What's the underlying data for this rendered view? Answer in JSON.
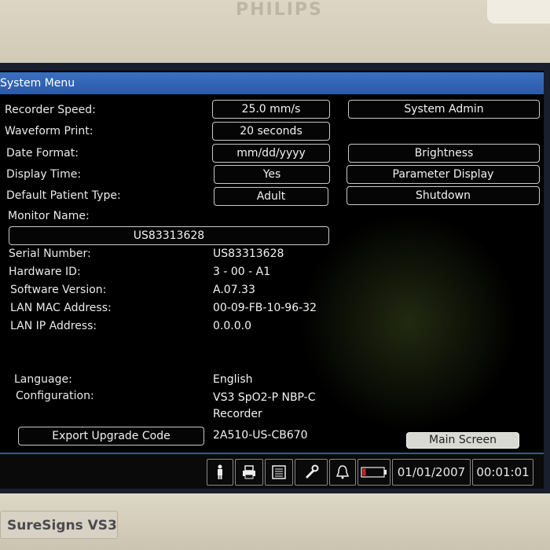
{
  "window": {
    "title": "System Menu"
  },
  "settings": {
    "recorder_speed": {
      "label": "Recorder Speed:",
      "value": "25.0 mm/s"
    },
    "waveform_print": {
      "label": "Waveform Print:",
      "value": "20 seconds"
    },
    "date_format": {
      "label": "Date Format:",
      "value": "mm/dd/yyyy"
    },
    "display_time": {
      "label": "Display Time:",
      "value": "Yes"
    },
    "default_patient_type": {
      "label": "Default Patient Type:",
      "value": "Adult"
    },
    "monitor_name": {
      "label": "Monitor Name:",
      "value": "US83313628"
    }
  },
  "right_buttons": {
    "system_admin": "System Admin",
    "brightness": "Brightness",
    "parameter_display": "Parameter Display",
    "shutdown": "Shutdown"
  },
  "info": {
    "serial_number": {
      "label": "Serial Number:",
      "value": "US83313628"
    },
    "hardware_id": {
      "label": "Hardware ID:",
      "value": "3 - 00 - A1"
    },
    "software_version": {
      "label": "Software Version:",
      "value": "A.07.33"
    },
    "lan_mac": {
      "label": "LAN MAC Address:",
      "value": "00-09-FB-10-96-32"
    },
    "lan_ip": {
      "label": "LAN IP Address:",
      "value": "0.0.0.0"
    },
    "language": {
      "label": "Language:",
      "value": "English"
    },
    "configuration": {
      "label": "Configuration:",
      "value_line1": "VS3 SpO2-P NBP-C",
      "value_line2": "Recorder"
    },
    "upgrade_code": {
      "button": "Export Upgrade Code",
      "value": "2A510-US-CB670"
    }
  },
  "main_screen_button": "Main Screen",
  "statusbar": {
    "date": "01/01/2007",
    "time": "00:01:01",
    "icons": [
      "patient-icon",
      "printer-icon",
      "document-icon",
      "wrench-icon",
      "alarm-bell-icon",
      "battery-icon"
    ]
  },
  "bezel": {
    "brand_top": "PHILIPS",
    "model_badge": "SureSigns VS3"
  },
  "colors": {
    "title_bar": "#2c5aa8",
    "screen_bg": "#000000",
    "bezel": "#ddd6c4",
    "battery_alert": "#cc2222"
  }
}
